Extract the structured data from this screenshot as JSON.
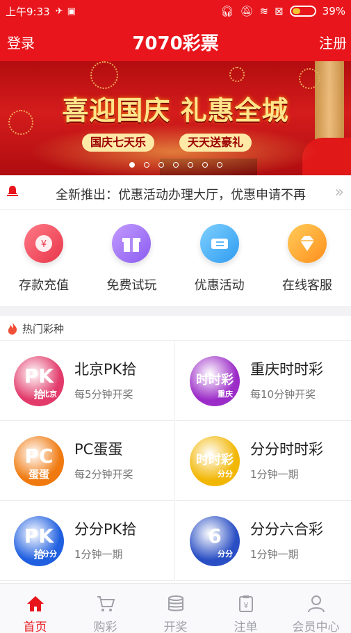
{
  "status_bar": {
    "time": "上午9:33",
    "battery": "39%",
    "battery_level": 0.39
  },
  "header": {
    "left_label": "登录",
    "title": "7070彩票",
    "right_label": "注册"
  },
  "banner": {
    "headline": "喜迎国庆 礼惠全城",
    "tags": [
      "国庆七天乐",
      "天天送豪礼"
    ],
    "slide_count": 7,
    "active_slide": 1
  },
  "notice": {
    "text": "全新推出：优惠活动办理大厅，优惠申请不再"
  },
  "quick_actions": [
    {
      "label": "存款充值",
      "icon": "deposit-icon",
      "color": "#e8364a"
    },
    {
      "label": "免费试玩",
      "icon": "gift-icon",
      "color": "#8a5cf0"
    },
    {
      "label": "优惠活动",
      "icon": "ticket-icon",
      "color": "#2f9cf0"
    },
    {
      "label": "在线客服",
      "icon": "diamond-icon",
      "color": "#ff8f1c"
    }
  ],
  "section": {
    "title": "热门彩种"
  },
  "games": [
    {
      "name": "北京PK拾",
      "desc": "每5分钟开奖",
      "logo_text": "PK",
      "logo_sub": "拾",
      "logo_tag": "北京",
      "color": "#e23a6a"
    },
    {
      "name": "重庆时时彩",
      "desc": "每10分钟开奖",
      "logo_text": "时时彩",
      "logo_sub": "",
      "logo_tag": "重庆",
      "color": "#9c2cc8"
    },
    {
      "name": "PC蛋蛋",
      "desc": "每2分钟开奖",
      "logo_text": "PC",
      "logo_sub": "蛋蛋",
      "logo_tag": "",
      "color": "#f07a10"
    },
    {
      "name": "分分时时彩",
      "desc": "1分钟一期",
      "logo_text": "时时彩",
      "logo_sub": "",
      "logo_tag": "分分",
      "color": "#f2b705"
    },
    {
      "name": "分分PK拾",
      "desc": "1分钟一期",
      "logo_text": "PK",
      "logo_sub": "拾",
      "logo_tag": "分分",
      "color": "#1f5fe0"
    },
    {
      "name": "分分六合彩",
      "desc": "1分钟一期",
      "logo_text": "6",
      "logo_sub": "",
      "logo_tag": "分分",
      "color": "#2a4fc4"
    }
  ],
  "tabs": [
    {
      "label": "首页",
      "icon": "home-icon",
      "active": true
    },
    {
      "label": "购彩",
      "icon": "cart-icon",
      "active": false
    },
    {
      "label": "开奖",
      "icon": "coins-icon",
      "active": false
    },
    {
      "label": "注单",
      "icon": "order-icon",
      "active": false
    },
    {
      "label": "会员中心",
      "icon": "user-icon",
      "active": false
    }
  ],
  "colors": {
    "brand_red": "#e8161c",
    "tab_inactive": "#a0a0a8"
  }
}
